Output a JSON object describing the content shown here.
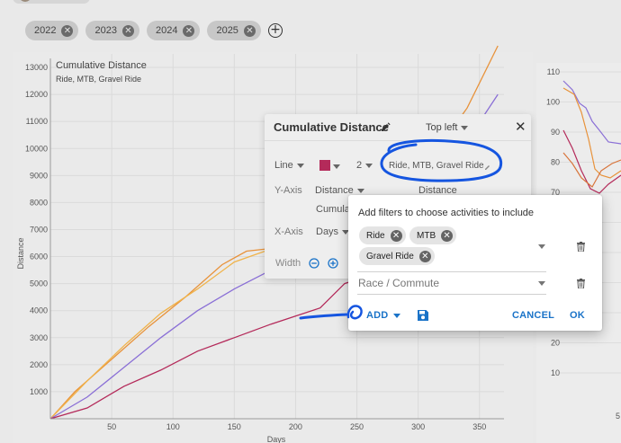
{
  "year_filters": [
    "2022",
    "2023",
    "2024",
    "2025"
  ],
  "main_chart": {
    "title": "Cumulative Distance",
    "subtitle": "Ride, MTB, Gravel Ride",
    "ylabel": "Distance",
    "xlabel": "Days"
  },
  "chart_data": {
    "type": "line",
    "title": "Cumulative Distance",
    "subtitle": "Ride, MTB, Gravel Ride",
    "xlabel": "Days",
    "ylabel": "Distance",
    "xlim": [
      0,
      370
    ],
    "ylim": [
      0,
      13500
    ],
    "xticks": [
      50,
      100,
      150,
      200,
      250,
      300,
      350
    ],
    "yticks": [
      1000,
      2000,
      3000,
      4000,
      5000,
      6000,
      7000,
      8000,
      9000,
      10000,
      11000,
      12000,
      13000
    ],
    "grid": true,
    "series": [
      {
        "color": "#e8923a",
        "x": [
          0,
          20,
          50,
          80,
          110,
          140,
          160,
          180,
          210,
          240,
          280,
          310,
          340,
          365
        ],
        "y": [
          0,
          1000,
          2200,
          3400,
          4500,
          5700,
          6200,
          6300,
          6400,
          6800,
          8000,
          9600,
          11500,
          13800
        ]
      },
      {
        "color": "#f0b34a",
        "x": [
          0,
          30,
          60,
          90,
          120,
          150,
          175,
          200
        ],
        "y": [
          0,
          1400,
          2700,
          3900,
          4800,
          5800,
          6200,
          6300
        ]
      },
      {
        "color": "#8a6fd6",
        "x": [
          0,
          30,
          60,
          90,
          120,
          150,
          180,
          210,
          240,
          270,
          300,
          330,
          365
        ],
        "y": [
          0,
          800,
          1900,
          3000,
          4000,
          4800,
          5500,
          6200,
          6800,
          7400,
          8200,
          9600,
          12000
        ]
      },
      {
        "color": "#b42a5a",
        "x": [
          0,
          30,
          60,
          90,
          120,
          150,
          180,
          200,
          220,
          240,
          260
        ],
        "y": [
          0,
          400,
          1200,
          1800,
          2500,
          3000,
          3500,
          3800,
          4100,
          5000,
          5300
        ]
      }
    ]
  },
  "settings_dialog": {
    "title": "Cumulative Distance",
    "position": "Top left",
    "chart_type": "Line",
    "line_width": "2",
    "filter_link": "Ride, MTB, Gravel Ride",
    "series_color": "#b42a5a",
    "yaxis_label": "Y-Axis",
    "yaxis_value": "Distance",
    "yaxis_right": "Distance",
    "yaxis_mode": "Cumula",
    "xaxis_label": "X-Axis",
    "xaxis_value": "Days",
    "width_label": "Width"
  },
  "filter_dialog": {
    "heading": "Add filters to choose activities to include",
    "activity_chips": [
      "Ride",
      "MTB",
      "Gravel Ride"
    ],
    "race_placeholder": "Race / Commute",
    "add_label": "ADD",
    "cancel_label": "CANCEL",
    "ok_label": "OK",
    "accent": "#1a73c8"
  },
  "right_chart": {
    "yticks": [
      "110",
      "100",
      "90",
      "80",
      "70",
      "60",
      "50",
      "40",
      "30",
      "20",
      "10"
    ],
    "xtick": "5"
  }
}
